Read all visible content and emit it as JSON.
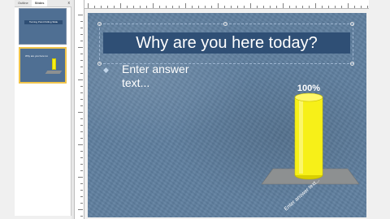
{
  "thumbnail_pane": {
    "tabs": [
      "Outline",
      "Slides"
    ],
    "close_glyph": "x",
    "slides": [
      {
        "title": "Turning Point Polling Slide"
      },
      {
        "text": "Why are you here today?"
      }
    ]
  },
  "slide": {
    "title": "Why are you here today?",
    "answer_text": "Enter answer text...",
    "bullet": "◆"
  },
  "chart_data": {
    "type": "bar",
    "categories": [
      "Enter answer text..."
    ],
    "values": [
      100
    ],
    "value_labels": [
      "100%"
    ],
    "ylim": [
      0,
      100
    ]
  },
  "colors": {
    "slide_background": "#5f7f9f",
    "title_bar": "#2f4f75",
    "bar": "#f7f018",
    "base": "#8d9091"
  }
}
